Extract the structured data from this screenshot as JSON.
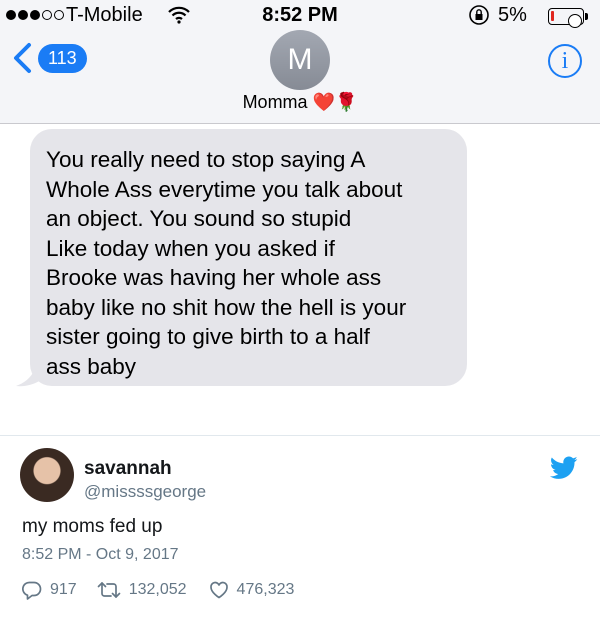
{
  "status_bar": {
    "carrier": "T-Mobile",
    "time": "8:52 PM",
    "battery_percent": "5%"
  },
  "messages_header": {
    "back_count": "113",
    "avatar_initial": "M",
    "contact_name": "Momma",
    "contact_emoji": "❤️🌹",
    "accent_color": "#1a7cf5"
  },
  "conversation": {
    "message_lines": [
      "You really need to stop saying A",
      "Whole Ass everytime you talk about",
      "an object. You sound so stupid",
      "Like today when you asked if",
      "Brooke was having her whole ass",
      "baby like no shit how the hell is your",
      "sister going to give birth to a half",
      "ass baby"
    ],
    "bubble_color": "#e5e5ea"
  },
  "tweet": {
    "display_name": "savannah",
    "handle": "@missssgeorge",
    "text": "my moms fed up",
    "timestamp": "8:52 PM - Oct 9, 2017",
    "replies": "917",
    "retweets": "132,052",
    "likes": "476,323",
    "twitter_blue": "#1da1f2"
  }
}
